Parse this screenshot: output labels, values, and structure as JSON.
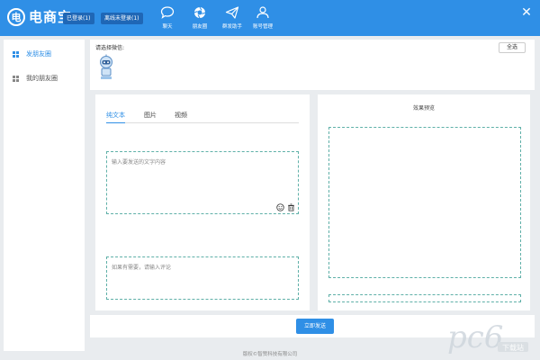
{
  "app": {
    "name": "电商宝",
    "logo_glyph": "电"
  },
  "header": {
    "logged_in_btn": "已登录(1)",
    "offline_btn": "离线未登录(1)",
    "nav": [
      {
        "label": "聊天",
        "icon": "chat-bubble-icon"
      },
      {
        "label": "朋友圈",
        "icon": "camera-aperture-icon"
      },
      {
        "label": "群发助手",
        "icon": "paper-plane-icon"
      },
      {
        "label": "账号管理",
        "icon": "user-settings-icon"
      }
    ],
    "close_glyph": "✕"
  },
  "sidebar": {
    "items": [
      {
        "label": "发朋友圈",
        "active": true
      },
      {
        "label": "我的朋友圈",
        "active": false
      }
    ]
  },
  "accounts": {
    "label": "请选择微信:",
    "select_all": "全选"
  },
  "editor": {
    "tabs": [
      {
        "label": "纯文本",
        "active": true
      },
      {
        "label": "图片",
        "active": false
      },
      {
        "label": "视频",
        "active": false
      }
    ],
    "text_placeholder": "输入要发送的文字内容",
    "comment_placeholder": "如果有需要，请输入评论"
  },
  "preview": {
    "title": "效果预览"
  },
  "send": {
    "button": "立即发送"
  },
  "footer": {
    "text": "版权©智赞科技有限公司"
  },
  "watermark": {
    "text": "pc6",
    "sub": "下载站"
  },
  "colors": {
    "brand_blue": "#2f8fe6",
    "dark_blue_btn": "#1f67b6",
    "dashed_border": "#5fb0a8",
    "background": "#e9ecef"
  }
}
